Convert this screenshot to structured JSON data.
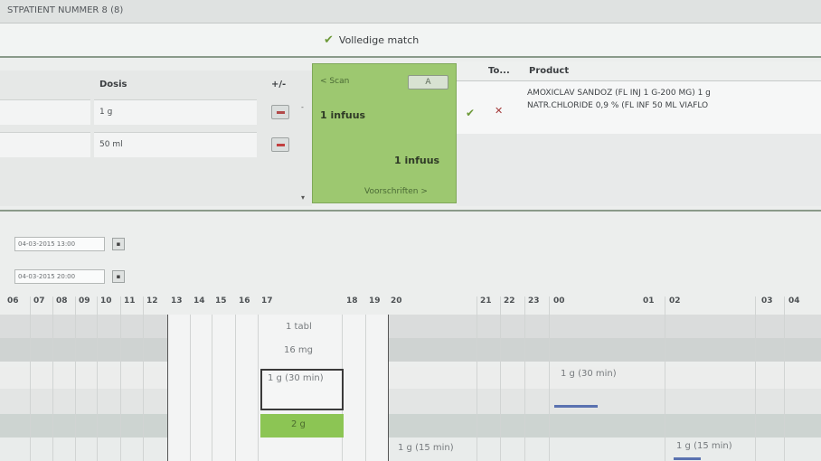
{
  "window": {
    "title": "STPATIENT NUMMER 8 (8)"
  },
  "match": {
    "label": "Volledige match"
  },
  "dosis_table": {
    "header_dosis": "Dosis",
    "header_plusminus": "+/-",
    "rows": [
      {
        "dosis": "1 g"
      },
      {
        "dosis": "50 ml"
      }
    ]
  },
  "scan_panel": {
    "scan_link": "< Scan",
    "button_label": "A",
    "infuus_top": "1 infuus",
    "infuus_bottom": "1 infuus",
    "voorschriften_link": "Voorschriften >"
  },
  "product_table": {
    "header_to": "To...",
    "header_product": "Product",
    "rows": [
      {
        "product": "AMOXICLAV SANDOZ (FL INJ 1 G-200 MG) 1 g"
      },
      {
        "product": "NATR.CHLORIDE 0,9 % (FL INF    50 ML VIAFLO"
      }
    ]
  },
  "dates": {
    "start": "04-03-2015 13:00",
    "end": "04-03-2015 20:00"
  },
  "timeline": {
    "hours_left": [
      "06",
      "07",
      "08",
      "09",
      "10",
      "11",
      "12",
      "13",
      "14",
      "15",
      "16",
      "17"
    ],
    "hours_mid": [
      "18",
      "19",
      "20"
    ],
    "hours_right": [
      "21",
      "22",
      "23",
      "00",
      "01",
      "02",
      "03",
      "04"
    ],
    "entries": {
      "tabl": "1 tabl",
      "mg": "16 mg",
      "g30_a": "1 g (30 min)",
      "g30_b": "1 g (30 min)",
      "g2": "2 g",
      "g15_a": "1 g (15 min)",
      "g15_b": "1 g (15 min)"
    }
  }
}
